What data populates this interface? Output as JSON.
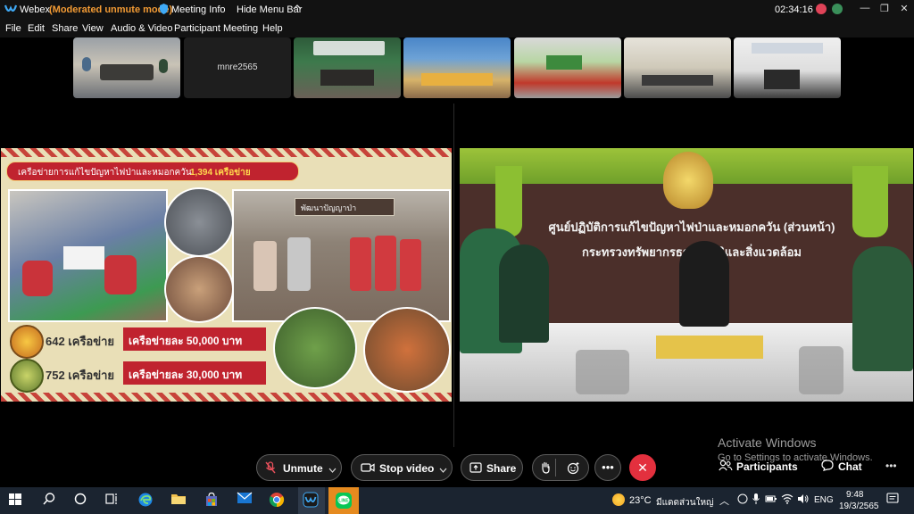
{
  "app": {
    "title": "Webex",
    "mode": "(Moderated unmute mode)",
    "meeting_info": "Meeting Info",
    "hide_menu": "Hide Menu Bar",
    "timer": "02:34:16",
    "accent": "#f39b34"
  },
  "menu": [
    "File",
    "Edit",
    "Share",
    "View",
    "Audio & Video",
    "Participant",
    "Meeting",
    "Help"
  ],
  "thumbnails": {
    "named_tile": "mnre2565"
  },
  "slide": {
    "banner_text": "เครือข่ายการแก้ไขปัญหาไฟป่าและหมอกควัน",
    "banner_count": "1,394 เครือข่าย",
    "row1_count": "642 เครือข่าย",
    "row1_amount": "เครือข่ายละ 50,000 บาท",
    "row2_count": "752 เครือข่าย",
    "row2_amount": "เครือข่ายละ 30,000 บาท",
    "sign_text": "พัฒนาปัญญาป่า"
  },
  "camera": {
    "banner_line1": "ศูนย์ปฏิบัติการแก้ไขปัญหาไฟป่าและหมอกควัน (ส่วนหน้า)",
    "banner_line2": "กระทรวงทรัพยากรธรรมชาติและสิ่งแวดล้อม"
  },
  "controls": {
    "unmute": "Unmute",
    "stop_video": "Stop video",
    "share": "Share",
    "participants": "Participants",
    "chat": "Chat"
  },
  "watermark": {
    "title": "Activate Windows",
    "subtitle": "Go to Settings to activate Windows."
  },
  "taskbar": {
    "weather_temp": "23°C",
    "weather_text": "มีแดดส่วนใหญ่",
    "lang": "ENG",
    "time": "9:48",
    "date": "19/3/2565"
  }
}
